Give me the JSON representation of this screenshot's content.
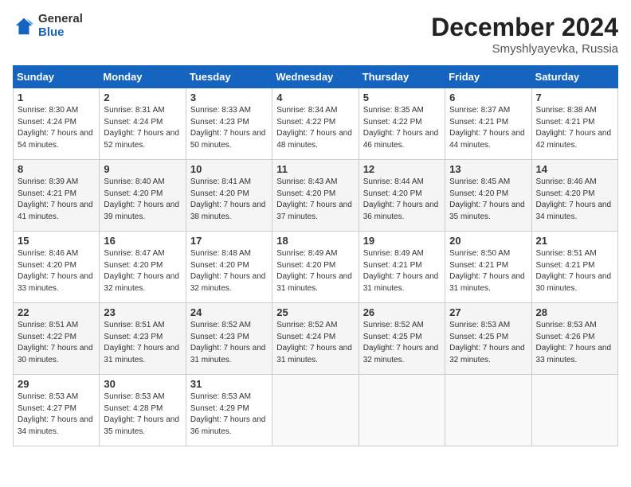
{
  "logo": {
    "general": "General",
    "blue": "Blue"
  },
  "title": "December 2024",
  "subtitle": "Smyshlyayevka, Russia",
  "headers": [
    "Sunday",
    "Monday",
    "Tuesday",
    "Wednesday",
    "Thursday",
    "Friday",
    "Saturday"
  ],
  "weeks": [
    [
      {
        "day": "1",
        "sunrise": "Sunrise: 8:30 AM",
        "sunset": "Sunset: 4:24 PM",
        "daylight": "Daylight: 7 hours and 54 minutes."
      },
      {
        "day": "2",
        "sunrise": "Sunrise: 8:31 AM",
        "sunset": "Sunset: 4:24 PM",
        "daylight": "Daylight: 7 hours and 52 minutes."
      },
      {
        "day": "3",
        "sunrise": "Sunrise: 8:33 AM",
        "sunset": "Sunset: 4:23 PM",
        "daylight": "Daylight: 7 hours and 50 minutes."
      },
      {
        "day": "4",
        "sunrise": "Sunrise: 8:34 AM",
        "sunset": "Sunset: 4:22 PM",
        "daylight": "Daylight: 7 hours and 48 minutes."
      },
      {
        "day": "5",
        "sunrise": "Sunrise: 8:35 AM",
        "sunset": "Sunset: 4:22 PM",
        "daylight": "Daylight: 7 hours and 46 minutes."
      },
      {
        "day": "6",
        "sunrise": "Sunrise: 8:37 AM",
        "sunset": "Sunset: 4:21 PM",
        "daylight": "Daylight: 7 hours and 44 minutes."
      },
      {
        "day": "7",
        "sunrise": "Sunrise: 8:38 AM",
        "sunset": "Sunset: 4:21 PM",
        "daylight": "Daylight: 7 hours and 42 minutes."
      }
    ],
    [
      {
        "day": "8",
        "sunrise": "Sunrise: 8:39 AM",
        "sunset": "Sunset: 4:21 PM",
        "daylight": "Daylight: 7 hours and 41 minutes."
      },
      {
        "day": "9",
        "sunrise": "Sunrise: 8:40 AM",
        "sunset": "Sunset: 4:20 PM",
        "daylight": "Daylight: 7 hours and 39 minutes."
      },
      {
        "day": "10",
        "sunrise": "Sunrise: 8:41 AM",
        "sunset": "Sunset: 4:20 PM",
        "daylight": "Daylight: 7 hours and 38 minutes."
      },
      {
        "day": "11",
        "sunrise": "Sunrise: 8:43 AM",
        "sunset": "Sunset: 4:20 PM",
        "daylight": "Daylight: 7 hours and 37 minutes."
      },
      {
        "day": "12",
        "sunrise": "Sunrise: 8:44 AM",
        "sunset": "Sunset: 4:20 PM",
        "daylight": "Daylight: 7 hours and 36 minutes."
      },
      {
        "day": "13",
        "sunrise": "Sunrise: 8:45 AM",
        "sunset": "Sunset: 4:20 PM",
        "daylight": "Daylight: 7 hours and 35 minutes."
      },
      {
        "day": "14",
        "sunrise": "Sunrise: 8:46 AM",
        "sunset": "Sunset: 4:20 PM",
        "daylight": "Daylight: 7 hours and 34 minutes."
      }
    ],
    [
      {
        "day": "15",
        "sunrise": "Sunrise: 8:46 AM",
        "sunset": "Sunset: 4:20 PM",
        "daylight": "Daylight: 7 hours and 33 minutes."
      },
      {
        "day": "16",
        "sunrise": "Sunrise: 8:47 AM",
        "sunset": "Sunset: 4:20 PM",
        "daylight": "Daylight: 7 hours and 32 minutes."
      },
      {
        "day": "17",
        "sunrise": "Sunrise: 8:48 AM",
        "sunset": "Sunset: 4:20 PM",
        "daylight": "Daylight: 7 hours and 32 minutes."
      },
      {
        "day": "18",
        "sunrise": "Sunrise: 8:49 AM",
        "sunset": "Sunset: 4:20 PM",
        "daylight": "Daylight: 7 hours and 31 minutes."
      },
      {
        "day": "19",
        "sunrise": "Sunrise: 8:49 AM",
        "sunset": "Sunset: 4:21 PM",
        "daylight": "Daylight: 7 hours and 31 minutes."
      },
      {
        "day": "20",
        "sunrise": "Sunrise: 8:50 AM",
        "sunset": "Sunset: 4:21 PM",
        "daylight": "Daylight: 7 hours and 31 minutes."
      },
      {
        "day": "21",
        "sunrise": "Sunrise: 8:51 AM",
        "sunset": "Sunset: 4:21 PM",
        "daylight": "Daylight: 7 hours and 30 minutes."
      }
    ],
    [
      {
        "day": "22",
        "sunrise": "Sunrise: 8:51 AM",
        "sunset": "Sunset: 4:22 PM",
        "daylight": "Daylight: 7 hours and 30 minutes."
      },
      {
        "day": "23",
        "sunrise": "Sunrise: 8:51 AM",
        "sunset": "Sunset: 4:23 PM",
        "daylight": "Daylight: 7 hours and 31 minutes."
      },
      {
        "day": "24",
        "sunrise": "Sunrise: 8:52 AM",
        "sunset": "Sunset: 4:23 PM",
        "daylight": "Daylight: 7 hours and 31 minutes."
      },
      {
        "day": "25",
        "sunrise": "Sunrise: 8:52 AM",
        "sunset": "Sunset: 4:24 PM",
        "daylight": "Daylight: 7 hours and 31 minutes."
      },
      {
        "day": "26",
        "sunrise": "Sunrise: 8:52 AM",
        "sunset": "Sunset: 4:25 PM",
        "daylight": "Daylight: 7 hours and 32 minutes."
      },
      {
        "day": "27",
        "sunrise": "Sunrise: 8:53 AM",
        "sunset": "Sunset: 4:25 PM",
        "daylight": "Daylight: 7 hours and 32 minutes."
      },
      {
        "day": "28",
        "sunrise": "Sunrise: 8:53 AM",
        "sunset": "Sunset: 4:26 PM",
        "daylight": "Daylight: 7 hours and 33 minutes."
      }
    ],
    [
      {
        "day": "29",
        "sunrise": "Sunrise: 8:53 AM",
        "sunset": "Sunset: 4:27 PM",
        "daylight": "Daylight: 7 hours and 34 minutes."
      },
      {
        "day": "30",
        "sunrise": "Sunrise: 8:53 AM",
        "sunset": "Sunset: 4:28 PM",
        "daylight": "Daylight: 7 hours and 35 minutes."
      },
      {
        "day": "31",
        "sunrise": "Sunrise: 8:53 AM",
        "sunset": "Sunset: 4:29 PM",
        "daylight": "Daylight: 7 hours and 36 minutes."
      },
      null,
      null,
      null,
      null
    ]
  ]
}
